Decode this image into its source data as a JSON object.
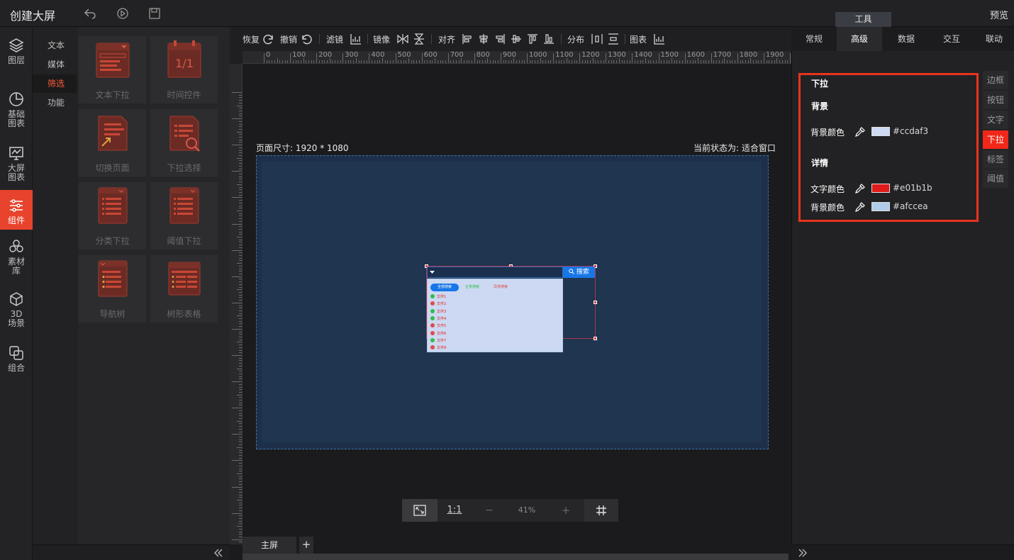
{
  "app": {
    "title": "创建大屏",
    "preview": "预览",
    "tools_tab": "工具"
  },
  "left_nav": [
    {
      "label": "图层",
      "icon": "layers-icon"
    },
    {
      "label": "基础图表",
      "icon": "pie-chart-icon"
    },
    {
      "label": "大屏图表",
      "icon": "monitor-chart-icon"
    },
    {
      "label": "组件",
      "icon": "sliders-icon",
      "active": true
    },
    {
      "label": "素材库",
      "icon": "hexagons-icon"
    },
    {
      "label": "3D场景",
      "icon": "cube-icon"
    },
    {
      "label": "组合",
      "icon": "combine-icon"
    }
  ],
  "categories": [
    {
      "label": "文本"
    },
    {
      "label": "媒体"
    },
    {
      "label": "筛选",
      "active": true
    },
    {
      "label": "功能"
    }
  ],
  "components": [
    {
      "label": "文本下拉",
      "icon": "text-dropdown-icon"
    },
    {
      "label": "时间控件",
      "icon": "calendar-icon"
    },
    {
      "label": "切换页面",
      "icon": "switch-page-icon"
    },
    {
      "label": "下拉选择",
      "icon": "dropdown-search-icon"
    },
    {
      "label": "分类下拉",
      "icon": "category-dropdown-icon"
    },
    {
      "label": "阈值下拉",
      "icon": "threshold-dropdown-icon"
    },
    {
      "label": "导航树",
      "icon": "nav-tree-icon"
    },
    {
      "label": "树形表格",
      "icon": "tree-table-icon"
    }
  ],
  "toolbar": {
    "redo": "恢复",
    "undo": "撤销",
    "filter": "滤镜",
    "mirror": "镜像",
    "align": "对齐",
    "distribute": "分布",
    "chart": "图表"
  },
  "ruler_ticks": [
    "0",
    "100",
    "200",
    "300",
    "400",
    "500",
    "600",
    "700",
    "800",
    "900",
    "1000",
    "1100",
    "1200",
    "1300",
    "1400",
    "1500",
    "1600",
    "1700",
    "1800",
    "1900",
    "20"
  ],
  "canvas": {
    "page_size": "页面尺寸: 1920 * 1080",
    "current_state": "当前状态为: 适合窗口"
  },
  "zoom": {
    "ratio_label": "1:1",
    "minus": "−",
    "level": "41%",
    "plus": "+"
  },
  "screens": {
    "tab": "主屏",
    "add": "+"
  },
  "widget": {
    "search_label": "搜索",
    "pills": [
      "全部搜索",
      "正常搜索",
      "异常搜索"
    ],
    "rows": [
      {
        "text": "文件1",
        "ok": true
      },
      {
        "text": "文件2",
        "ok": false
      },
      {
        "text": "文件3",
        "ok": true
      },
      {
        "text": "文件4",
        "ok": true
      },
      {
        "text": "文件5",
        "ok": false
      },
      {
        "text": "文件6",
        "ok": false
      },
      {
        "text": "文件7",
        "ok": true
      },
      {
        "text": "文件8",
        "ok": false
      }
    ]
  },
  "right_panel": {
    "tabs": [
      {
        "label": "常规"
      },
      {
        "label": "高级",
        "active": true
      },
      {
        "label": "数据"
      },
      {
        "label": "交互"
      },
      {
        "label": "联动"
      }
    ],
    "subtabs": [
      {
        "label": "边框"
      },
      {
        "label": "按钮"
      },
      {
        "label": "文字"
      },
      {
        "label": "下拉",
        "active": true
      },
      {
        "label": "标签"
      },
      {
        "label": "阈值"
      }
    ],
    "section_title": "下拉",
    "background": {
      "title": "背景",
      "color_label": "背景颜色",
      "color": "#ccdaf3"
    },
    "details": {
      "title": "详情",
      "text_color_label": "文字颜色",
      "text_color": "#e01b1b",
      "bg_color_label": "背景颜色",
      "bg_color": "#afccea"
    }
  },
  "colors": {
    "accent": "#e8432d",
    "selected_subtab": "#f0281a",
    "page_bg": "#1e3049"
  }
}
